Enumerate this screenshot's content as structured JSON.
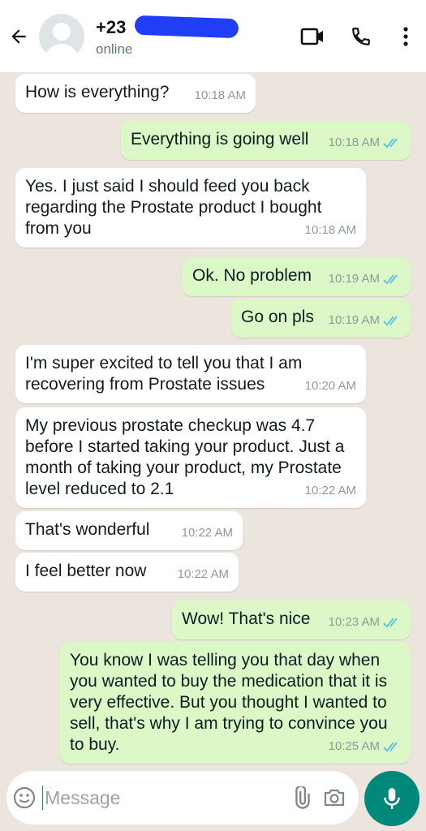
{
  "header": {
    "contact_name": "+23",
    "status": "online",
    "icons": [
      "back-arrow-icon",
      "avatar",
      "video-call-icon",
      "voice-call-icon",
      "more-options-icon"
    ]
  },
  "messages": [
    {
      "direction": "in",
      "text": "How is everything?",
      "time": "10:18 AM"
    },
    {
      "direction": "out",
      "text": "Everything is going well",
      "time": "10:18 AM",
      "read": true
    },
    {
      "direction": "in",
      "text": "Yes. I just said I should feed you back regarding the Prostate product I bought from you",
      "time": "10:18 AM"
    },
    {
      "direction": "out",
      "text": "Ok. No problem",
      "time": "10:19 AM",
      "read": true
    },
    {
      "direction": "out",
      "text": "Go on pls",
      "time": "10:19 AM",
      "read": true
    },
    {
      "direction": "in",
      "text": "I'm super excited to tell you that I am recovering from Prostate issues",
      "time": "10:20 AM"
    },
    {
      "direction": "in",
      "text": "My previous prostate checkup was 4.7 before I started taking your product. Just a month of taking your product, my Prostate level reduced to 2.1",
      "time": "10:22 AM"
    },
    {
      "direction": "in",
      "text": "That's wonderful",
      "time": "10:22 AM"
    },
    {
      "direction": "in",
      "text": "I feel better now",
      "time": "10:22 AM"
    },
    {
      "direction": "out",
      "text": "Wow! That's nice",
      "time": "10:23 AM",
      "read": true
    },
    {
      "direction": "out",
      "text": "You know I was telling you that day when you wanted to buy the medication that it is very effective.  But you thought I wanted to sell, that's why I am trying to convince you to buy.",
      "time": "10:25 AM",
      "read": true
    }
  ],
  "composer": {
    "placeholder": "Message",
    "icons": [
      "emoji-icon",
      "attach-icon",
      "camera-icon",
      "mic-icon"
    ]
  },
  "colors": {
    "chat_background": "#ece5dd",
    "incoming_bubble": "#ffffff",
    "outgoing_bubble": "#dcf8c6",
    "read_ticks": "#53bdeb",
    "accent": "#00897b"
  }
}
